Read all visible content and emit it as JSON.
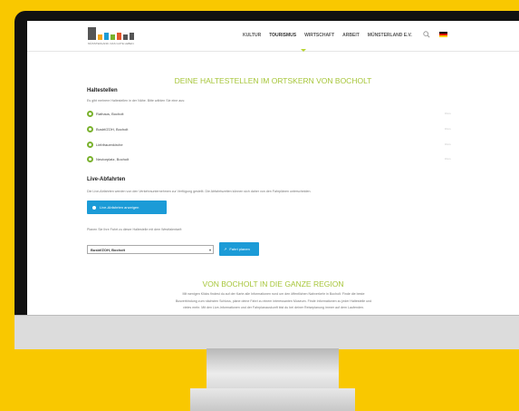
{
  "header": {
    "logo_text": "MÜNSTERLAND. DAS GUTE LEBEN.",
    "nav": [
      "KULTUR",
      "TOURISMUS",
      "WIRTSCHAFT",
      "ARBEIT",
      "MÜNSTERLAND E.V."
    ],
    "active_nav": "TOURISMUS"
  },
  "main": {
    "heading": "DEINE HALTESTELLEN IM ORTSKERN VON BOCHOLT",
    "stops_title": "Haltestellen",
    "stops_intro": "Es gibt mehrere Haltestellen in der Nähe. Bitte wählen Sie eine aus:",
    "stops": [
      {
        "name": "Rathaus, Bocholt",
        "dist": "0 km"
      },
      {
        "name": "Busbf/ZOH, Bocholt",
        "dist": "0 km"
      },
      {
        "name": "Liebfrauenkirche",
        "dist": "0 km"
      },
      {
        "name": "Neutorplatz, Bocholt",
        "dist": "0 km"
      }
    ],
    "live_title": "Live-Abfahrten",
    "live_text": "Die Live-Abfahrten werden von den Verkehrsunternehmen zur Verfügung gestellt. Die Abfahrtszeiten können sich daher von den Fahrplänen unterscheiden.",
    "live_button": "Live-Abfahrten anzeigen",
    "plan_text": "Planen Sie Ihre Fahrt zu dieser Haltestelle mit dem Westfalentarif:",
    "select_value": "Busbf/ZOH, Bocholt",
    "plan_button": "Fahrt planen",
    "region_heading": "VON BOCHOLT IN DIE GANZE REGION",
    "region_lines": [
      "Mit wenigen Klicks findest du auf der Karte alle Informationen rund um den öffentlichen Nahverkehr in Bocholt. Finde die beste",
      "Busverbindung zum nächsten Schloss, plane deine Fahrt zu einem interessanten Museum. Finde Informationen zu jeder Haltestelle und",
      "vieles mehr. Mit den Live-Informationen und der Fahrplanauskunft bist du bei deiner Reiseplanung immer auf dem Laufenden."
    ]
  },
  "colors": {
    "background": "#f9c800",
    "accent_green": "#a7c63a",
    "button_blue": "#1b9bd7"
  },
  "icons": [
    "search-icon",
    "german-flag-icon",
    "bus-stop-icon",
    "live-icon",
    "route-icon"
  ]
}
